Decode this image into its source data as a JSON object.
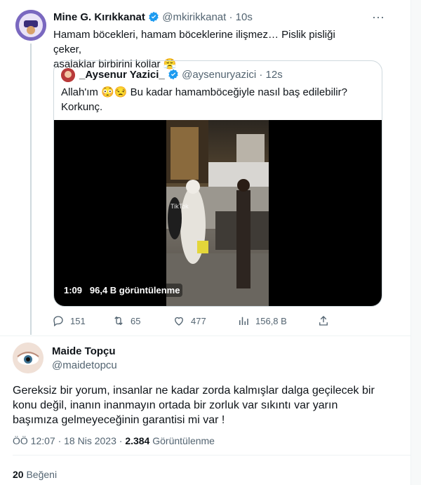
{
  "tweet1": {
    "name": "Mine G. Kırıkkanat",
    "handle": "@mkirikkanat",
    "time": "· 10s",
    "text_line1": "Hamam böcekleri, hamam böceklerine ilişmez… Pislik pisliği çeker,",
    "text_line2": "asalaklar birbirini kollar",
    "emoji": "😤"
  },
  "quote": {
    "name": "_Aysenur Yazici_",
    "handle": "@aysenuryazici",
    "time": "· 12s",
    "text_line1": "Allah'ım 😳😒 Bu kadar hamamböceğiyle nasıl baş edilebilir?",
    "text_line2": "Korkunç.",
    "video_duration": "1:09",
    "video_views": "96,4 B görüntülenme",
    "watermark": "TikTok"
  },
  "actions": {
    "replies": "151",
    "retweets": "65",
    "likes": "477",
    "views": "156,8 B"
  },
  "tweet2": {
    "name": "Maide Topçu",
    "handle": "@maidetopcu",
    "text_line1": "Gereksiz bir yorum, insanlar ne kadar zorda kalmışlar dalga geçilecek bir",
    "text_line2": "konu değil, inanın inanmayın ortada bir zorluk var sıkıntı var yarın",
    "text_line3": "başımıza gelmeyeceğinin garantisi mi var !",
    "time": "ÖÖ 12:07 · 18 Nis 2023 · ",
    "views_count": "2.384",
    "views_label": " Görüntülenme",
    "likes_count": "20",
    "likes_label": " Beğeni"
  },
  "colors": {
    "verified": "#1d9bf0",
    "text": "#0f1419",
    "muted": "#536471",
    "border": "#cfd9de"
  }
}
